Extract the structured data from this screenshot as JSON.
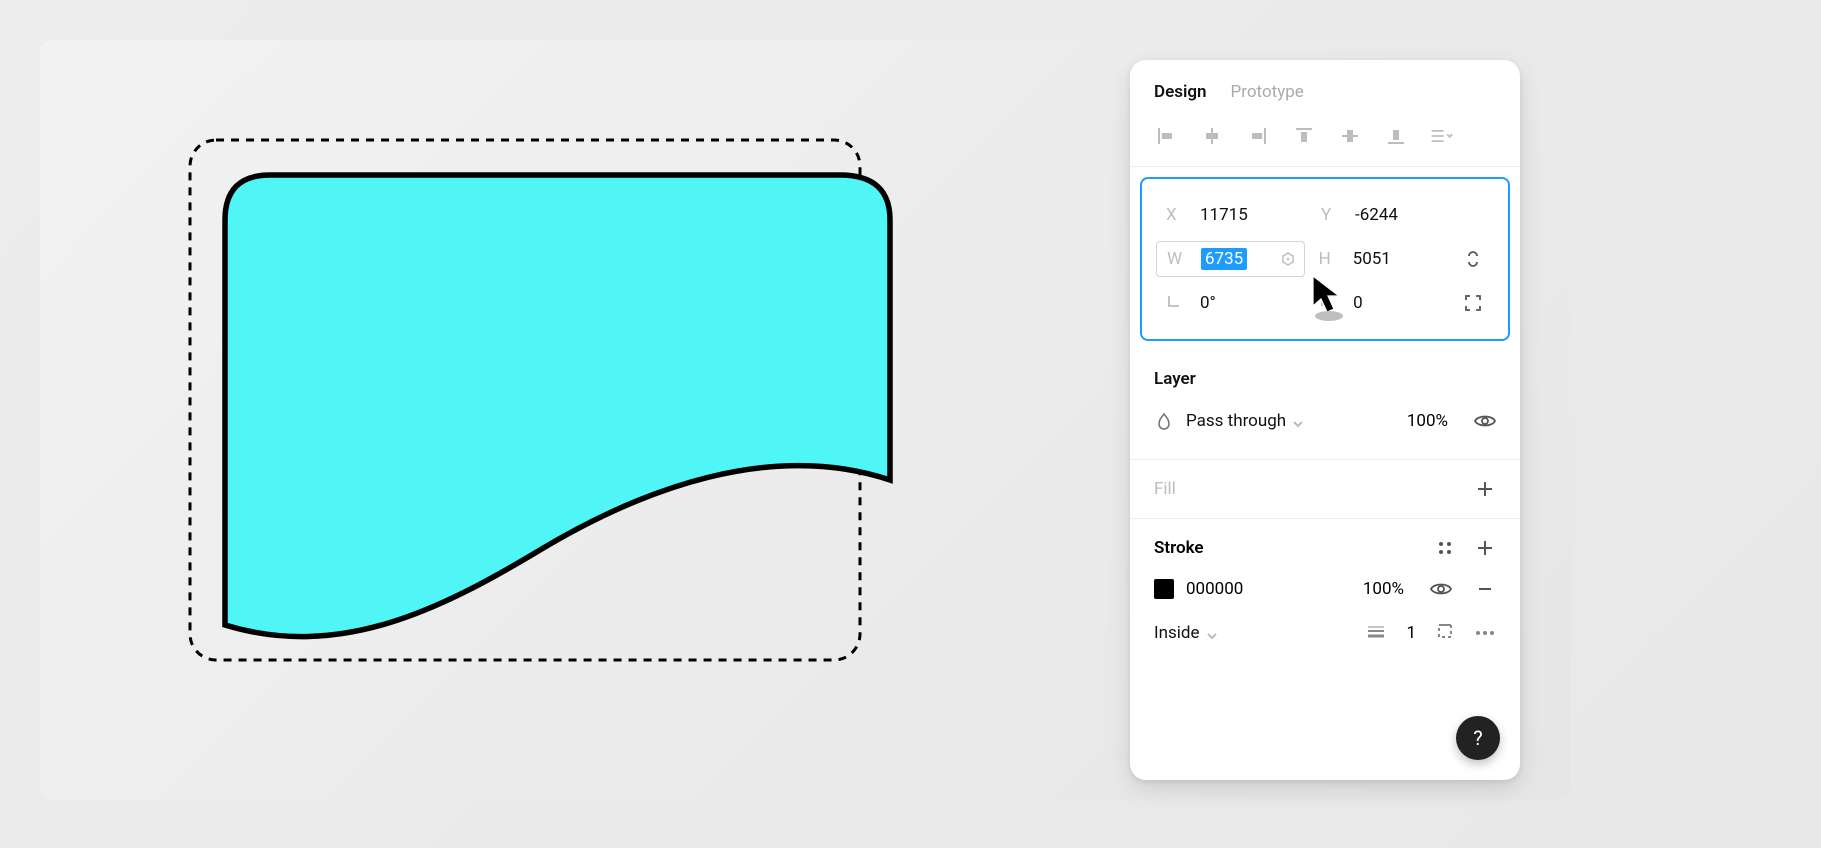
{
  "tabs": {
    "design": "Design",
    "prototype": "Prototype"
  },
  "transform": {
    "x_label": "X",
    "x": "11715",
    "y_label": "Y",
    "y": "-6244",
    "w_label": "W",
    "w": "6735",
    "h_label": "H",
    "h": "5051",
    "rot_label": "",
    "rot": "0°",
    "rad_label": "",
    "rad": "0"
  },
  "layer": {
    "title": "Layer",
    "blend": "Pass through",
    "opacity": "100%"
  },
  "fill": {
    "title": "Fill"
  },
  "stroke": {
    "title": "Stroke",
    "color_hex": "000000",
    "opacity": "100%",
    "position": "Inside",
    "weight": "1"
  },
  "help": "?",
  "canvas_shape": {
    "fill": "#50F5F5",
    "stroke": "#000000"
  }
}
